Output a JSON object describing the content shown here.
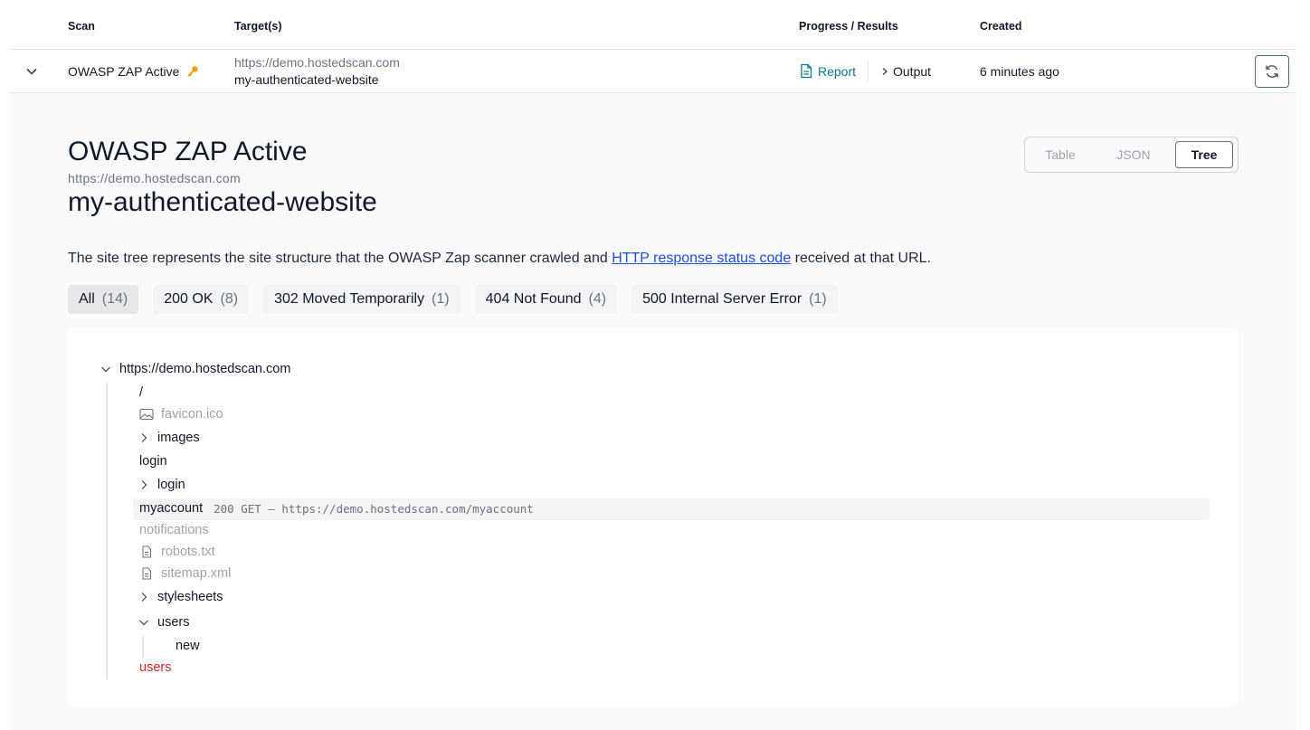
{
  "table": {
    "headers": {
      "scan": "Scan",
      "targets": "Target(s)",
      "progress": "Progress / Results",
      "created": "Created"
    },
    "row": {
      "scan_name": "OWASP ZAP Active",
      "target_host": "https://demo.hostedscan.com",
      "target_name": "my-authenticated-website",
      "report_label": "Report",
      "output_label": "Output",
      "created": "6 minutes ago"
    }
  },
  "detail": {
    "title": "OWASP ZAP Active",
    "host": "https://demo.hostedscan.com",
    "name": "my-authenticated-website",
    "view_tabs": {
      "table": "Table",
      "json": "JSON",
      "tree": "Tree",
      "selected": "Tree"
    },
    "description_before": "The site tree represents the site structure that the OWASP Zap scanner crawled and ",
    "description_link": "HTTP response status code",
    "description_after": " received at that URL.",
    "filters": [
      {
        "label": "All",
        "count": "(14)",
        "active": true
      },
      {
        "label": "200 OK",
        "count": "(8)"
      },
      {
        "label": "302 Moved Temporarily",
        "count": "(1)"
      },
      {
        "label": "404 Not Found",
        "count": "(4)"
      },
      {
        "label": "500 Internal Server Error",
        "count": "(1)"
      }
    ],
    "tree": {
      "root": "https://demo.hostedscan.com",
      "nodes": {
        "slash": "/",
        "favicon": "favicon.ico",
        "images": "images",
        "login_leaf": "login",
        "login_folder": "login",
        "myaccount": "myaccount",
        "myaccount_meta": "200 GET — https://demo.hostedscan.com/myaccount",
        "notifications": "notifications",
        "robots": "robots.txt",
        "sitemap": "sitemap.xml",
        "stylesheets": "stylesheets",
        "users_folder": "users",
        "new": "new",
        "users_error": "users"
      }
    }
  },
  "colors": {
    "accent": "#0e7490",
    "link": "#1d4ed8",
    "error": "#dc2626",
    "key_icon": "#f59e0b"
  }
}
